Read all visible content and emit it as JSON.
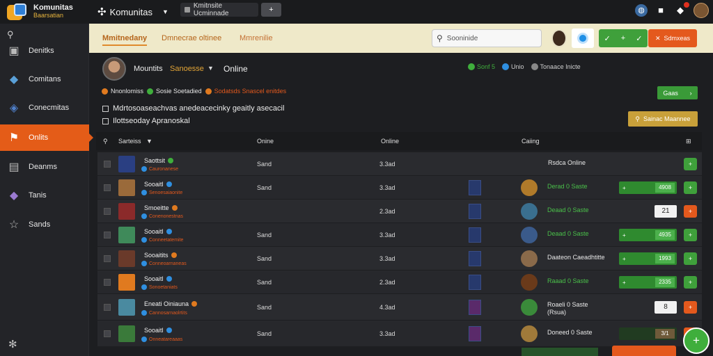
{
  "topbar": {
    "brand_name": "Komunitas",
    "brand_sub": "Baarsatian",
    "app_title": "Komunitas",
    "tab_label": "Kmitnsite Ucminnade",
    "new_tab": "+"
  },
  "sidebar": {
    "items": [
      {
        "label": "Denitks",
        "icon": "box-icon"
      },
      {
        "label": "Comitans",
        "icon": "cube-icon"
      },
      {
        "label": "Conecmitas",
        "icon": "cube-blue-icon"
      },
      {
        "label": "Onlits",
        "icon": "flag-icon",
        "active": true
      },
      {
        "label": "Deanms",
        "icon": "building-icon"
      },
      {
        "label": "Tanis",
        "icon": "cube-purple-icon"
      },
      {
        "label": "Sands",
        "icon": "star-icon"
      }
    ]
  },
  "subbar": {
    "tabs": [
      "Mmitnedany",
      "Dmnecrae oltinee",
      "Mmrenilie"
    ],
    "search_placeholder": "Sooninide",
    "green_btn": "+",
    "orange_btn": "Sdmxeas"
  },
  "profile": {
    "name": "Mountits",
    "role": "Sanoesse",
    "status": "Online",
    "stats": [
      {
        "text": "Sonf 5",
        "color": "#3fae3c"
      },
      {
        "text": "Unio",
        "color": "#2f8fe0"
      },
      {
        "text": "Tonaace Inicte",
        "color": "#888888"
      }
    ]
  },
  "badges": [
    {
      "text": "Nnonlomiss",
      "color": "#e07a1f"
    },
    {
      "text": "Sosie Soetadied",
      "color": "#3fae3c"
    },
    {
      "text": "Sodatsds Snascel enitdes",
      "color": "#e07a1f"
    }
  ],
  "green_small_btn": "Gaas",
  "checks": [
    "Mdrtosoaseachvas anedeacecinky geaitly asecacil",
    "Ilottseoday Apranoskal"
  ],
  "gold_btn": "Sainac Maannee",
  "table": {
    "headers": [
      "Sarteiss",
      "Onine",
      "Online",
      "Caiing"
    ],
    "mid_header": "Rsdca Online",
    "rows": [
      {
        "name": "Saottsit",
        "dot": "#3fae3c",
        "sub": "Cauronanese",
        "c1": "Sand",
        "c2": "3.3ad",
        "icon": "#2a3f82",
        "hero": false,
        "champ": "",
        "stat": "Rsdca Online",
        "stat_class": "wh",
        "action": "+",
        "act_class": "g",
        "box": "",
        "bar": ""
      },
      {
        "name": "Sooaitl",
        "dot": "#2f8fe0",
        "sub": "Senoesaiaonite",
        "c1": "Sand",
        "c2": "3.3ad",
        "icon": "#9a6a3a",
        "hero": true,
        "champ": "#b07a2a",
        "stat": "Derad 0 Saste",
        "stat_class": "",
        "action": "+",
        "act_class": "g",
        "box": "",
        "bar": "4908"
      },
      {
        "name": "Smoeitte",
        "dot": "#e07a1f",
        "sub": "Conenonestnas",
        "c1": "",
        "c2": "2.3ad",
        "icon": "#8b2a2a",
        "hero": true,
        "champ": "#3a6f8f",
        "stat": "Deaad 0 Saste",
        "stat_class": "",
        "action": "+",
        "act_class": "o",
        "box": "21",
        "bar": ""
      },
      {
        "name": "Sooaitl",
        "dot": "#2f8fe0",
        "sub": "Conneetatemite",
        "c1": "Sand",
        "c2": "3.3ad",
        "icon": "#3f8a5a",
        "hero": true,
        "champ": "#3a5a8a",
        "stat": "Deaad 0 Saste",
        "stat_class": "",
        "action": "+",
        "act_class": "g",
        "box": "",
        "bar": "4935"
      },
      {
        "name": "Sooaitits",
        "dot": "#e07a1f",
        "sub": "Conneoarnaneas",
        "c1": "Sand",
        "c2": "3.3ad",
        "icon": "#6a3a2a",
        "hero": true,
        "champ": "#8a6a4a",
        "stat": "Daateon Caeadhtitte",
        "stat_class": "wh",
        "action": "+",
        "act_class": "g",
        "box": "",
        "bar": "1993"
      },
      {
        "name": "Sooaitl",
        "dot": "#2f8fe0",
        "sub": "Sonoetaniats",
        "c1": "Sand",
        "c2": "2.3ad",
        "icon": "#e07a1f",
        "hero": true,
        "champ": "#6a3a1a",
        "stat": "Raaad 0 Saste",
        "stat_class": "",
        "action": "+",
        "act_class": "g",
        "box": "",
        "bar": "2335"
      },
      {
        "name": "Eneati Oiniauna",
        "dot": "#e07a1f",
        "sub": "Cannosarnaolrtits",
        "c1": "Sand",
        "c2": "4.3ad",
        "icon": "#4a8aa0",
        "hero": true,
        "champ": "#3a8a3a",
        "stat": "Roaeli 0 Saste (Rsua)",
        "stat_class": "wh",
        "action": "+",
        "act_class": "o",
        "box": "8",
        "bar": ""
      },
      {
        "name": "Sooaitl",
        "dot": "#2f8fe0",
        "sub": "Onneatareaaas",
        "c1": "Sand",
        "c2": "3.3ad",
        "icon": "#3a7a3a",
        "hero": true,
        "champ": "#a07a3a",
        "stat": "Doneed 0 Saste",
        "stat_class": "wh",
        "action": "+",
        "act_class": "o",
        "box": "",
        "bar": "3/1"
      }
    ]
  },
  "fab": "+"
}
